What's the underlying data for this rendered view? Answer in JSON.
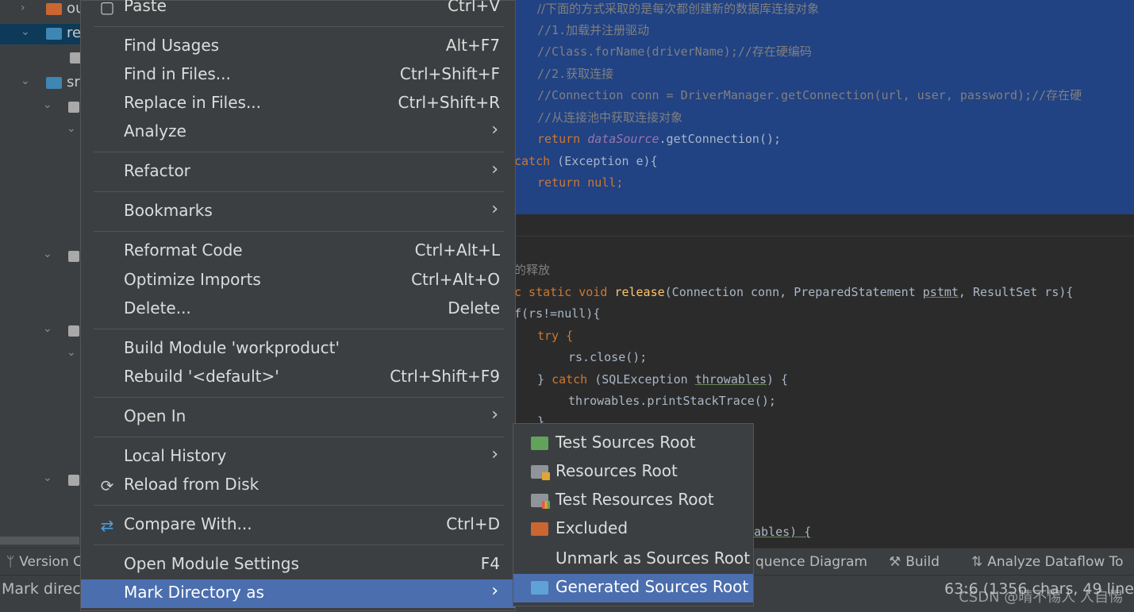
{
  "project_tree": {
    "items": [
      {
        "label": "ou",
        "icon": "folder-orange-icon",
        "chevron": "›"
      },
      {
        "label": "re",
        "icon": "folder-blue-icon",
        "chevron": "⌄",
        "selected": true
      },
      {
        "label": "",
        "icon": "file-icon"
      },
      {
        "label": "sr",
        "icon": "folder-blue-icon",
        "chevron": "⌄"
      }
    ]
  },
  "editor": {
    "lines_top": [
      "//下面的方式采取的是每次都创建新的数据库连接对象",
      "//1.加载并注册驱动",
      "//Class.forName(driverName);//存在硬编码",
      "//2.获取连接",
      "//Connection conn = DriverManager.getConnection(url, user, password);//存在硬",
      "//从连接池中获取连接对象"
    ],
    "return_kw": "return ",
    "datasource": "dataSource",
    "get_conn": ".getConnection();",
    "catch_kw": "catch",
    "catch_rest": " (Exception e){",
    "return_null": "return null;",
    "comment_release": "的释放",
    "release_static": "c static void ",
    "release_name": "release",
    "release_args_a": "(Connection conn, PreparedStatement ",
    "release_pstmt": "pstmt",
    "release_args_b": ", ResultSet rs){",
    "if_line": "f(rs!=null){",
    "try_line": "try {",
    "rs_close": "rs.close();",
    "catch2_a": "} ",
    "catch2_kw": "catch",
    "catch2_b": " (SQLException ",
    "catch2_var": "throwables",
    "catch2_c": ") {",
    "print_trace": "throwables.printStackTrace();",
    "brace": "}",
    "ables_line": "ables) {"
  },
  "context_menu": {
    "items": [
      {
        "id": "paste",
        "label": "Paste",
        "shortcut": "Ctrl+V",
        "icon": "paste-icon"
      },
      {
        "id": "find-usages",
        "label": "Find Usages",
        "shortcut": "Alt+F7"
      },
      {
        "id": "find-in-files",
        "label": "Find in Files...",
        "shortcut": "Ctrl+Shift+F"
      },
      {
        "id": "replace-in-files",
        "label": "Replace in Files...",
        "shortcut": "Ctrl+Shift+R"
      },
      {
        "id": "analyze",
        "label": "Analyze",
        "submenu": true
      },
      {
        "id": "refactor",
        "label": "Refactor",
        "submenu": true
      },
      {
        "id": "bookmarks",
        "label": "Bookmarks",
        "submenu": true
      },
      {
        "id": "reformat-code",
        "label": "Reformat Code",
        "shortcut": "Ctrl+Alt+L"
      },
      {
        "id": "optimize-imports",
        "label": "Optimize Imports",
        "shortcut": "Ctrl+Alt+O"
      },
      {
        "id": "delete",
        "label": "Delete...",
        "shortcut": "Delete"
      },
      {
        "id": "build-module",
        "label": "Build Module 'workproduct'"
      },
      {
        "id": "rebuild",
        "label": "Rebuild '<default>'",
        "shortcut": "Ctrl+Shift+F9"
      },
      {
        "id": "open-in",
        "label": "Open In",
        "submenu": true
      },
      {
        "id": "local-history",
        "label": "Local History",
        "submenu": true
      },
      {
        "id": "reload-from-disk",
        "label": "Reload from Disk",
        "icon": "reload-icon"
      },
      {
        "id": "compare-with",
        "label": "Compare With...",
        "shortcut": "Ctrl+D",
        "icon": "compare-icon"
      },
      {
        "id": "open-module-settings",
        "label": "Open Module Settings",
        "shortcut": "F4"
      },
      {
        "id": "mark-directory-as",
        "label": "Mark Directory as",
        "submenu": true,
        "active": true
      }
    ],
    "arrow_glyph": "›"
  },
  "submenu": {
    "items": [
      {
        "id": "test-sources-root",
        "label": "Test Sources Root",
        "icon": "folder-green-icon"
      },
      {
        "id": "resources-root",
        "label": "Resources Root",
        "icon": "resources-folder-icon"
      },
      {
        "id": "test-resources-root",
        "label": "Test Resources Root",
        "icon": "test-resources-folder-icon"
      },
      {
        "id": "excluded",
        "label": "Excluded",
        "icon": "folder-orange-icon"
      },
      {
        "id": "unmark-sources-root",
        "label": "Unmark as Sources Root"
      },
      {
        "id": "generated-sources-root",
        "label": "Generated Sources Root",
        "icon": "generated-folder-icon",
        "active": true
      }
    ]
  },
  "toolbar": {
    "version_control": "Version C",
    "sequence_diagram": "quence Diagram",
    "build": "Build",
    "analyze_dataflow": "Analyze Dataflow To"
  },
  "statusbar": {
    "message": "Mark direct",
    "position": "63:6 (1356 chars, 49 line"
  },
  "watermark": "CSDN @晴不惕人 人自惕",
  "colors": {
    "menu_bg": "#3c3f41",
    "menu_highlight": "#4b6eaf",
    "editor_selection": "#214283",
    "keyword": "#cc7832",
    "comment": "#808080"
  }
}
